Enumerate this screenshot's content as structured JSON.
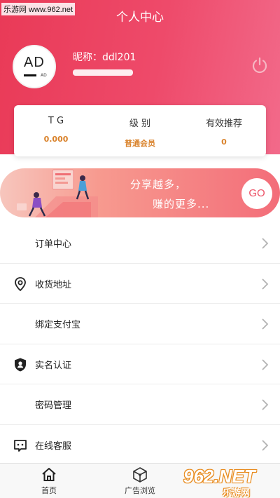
{
  "watermark": {
    "top_left": "乐游网 www.962.net",
    "brand": "962.NET",
    "brand_sub": "乐游网"
  },
  "header": {
    "title": "个人中心",
    "nickname": "昵称：ddl201",
    "avatar_text": "AD",
    "avatar_small": "AD"
  },
  "stats": [
    {
      "label": "T G",
      "value": "0.000"
    },
    {
      "label": "级 别",
      "value": "普通会员"
    },
    {
      "label": "有效推荐",
      "value": "0"
    }
  ],
  "banner": {
    "line1": "分享越多，",
    "line2": "赚的更多...",
    "go": "GO"
  },
  "menu": [
    {
      "label": "订单中心",
      "icon": "none"
    },
    {
      "label": "收货地址",
      "icon": "location-pin-icon"
    },
    {
      "label": "绑定支付宝",
      "icon": "none"
    },
    {
      "label": "实名认证",
      "icon": "shield-user-icon"
    },
    {
      "label": "密码管理",
      "icon": "none"
    },
    {
      "label": "在线客服",
      "icon": "chat-icon"
    }
  ],
  "nav": [
    {
      "label": "首页",
      "icon": "home-icon"
    },
    {
      "label": "广告浏览",
      "icon": "cube-icon"
    }
  ],
  "colors": {
    "accent": "#e93a57",
    "value_orange": "#d9822b"
  }
}
